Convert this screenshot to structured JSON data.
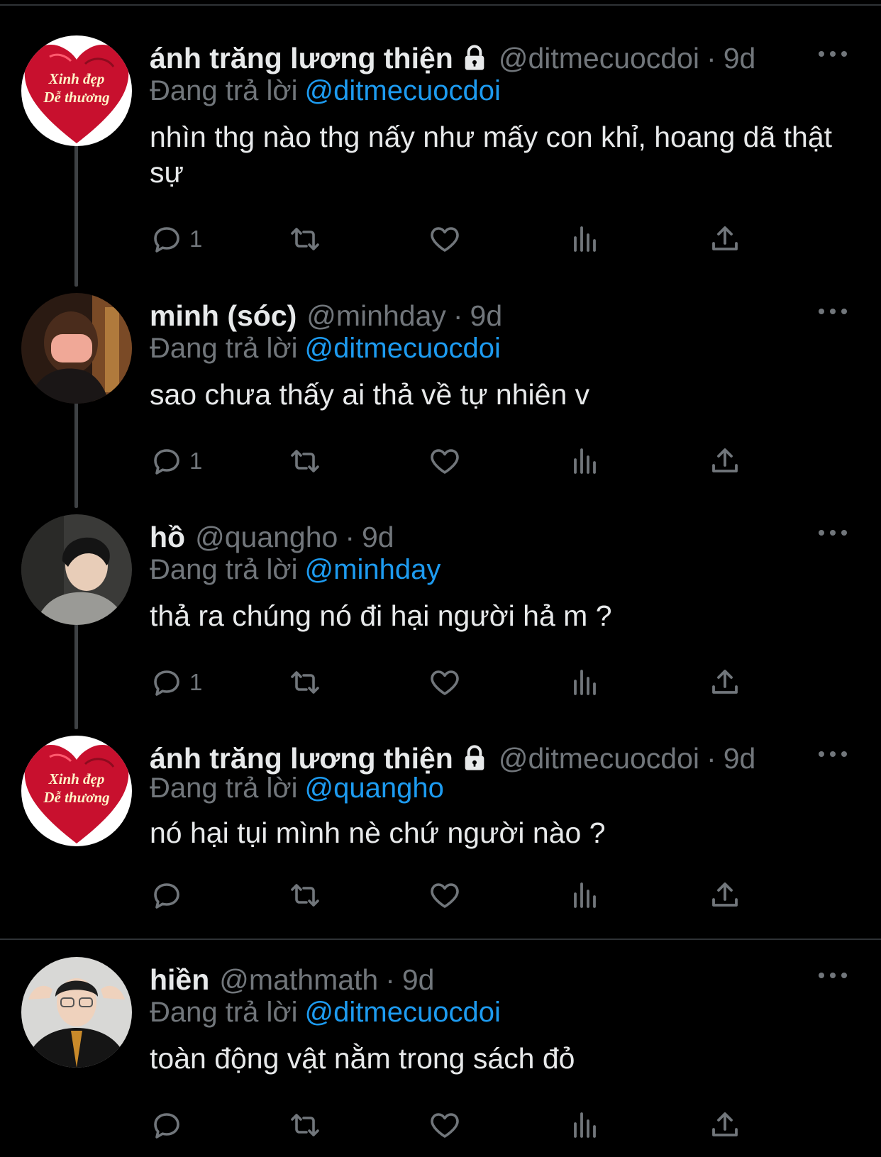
{
  "reply_prefix": "Đang trả lời",
  "tweets": [
    {
      "name": "ánh trăng lương thiện",
      "locked": true,
      "handle": "@ditmecuocdoi",
      "separator": "·",
      "time": "9d",
      "replying_to": "@ditmecuocdoi",
      "text": "nhìn thg nào thg nấy như mấy con khỉ, hoang dã thật sự",
      "reply_count": "1",
      "avatar": {
        "type": "heart",
        "line1": "Xinh đẹp",
        "line2": "Dễ thương"
      }
    },
    {
      "name": "minh (sóc)",
      "locked": false,
      "handle": "@minhday",
      "separator": "·",
      "time": "9d",
      "replying_to": "@ditmecuocdoi",
      "text": "sao chưa thấy ai thả về tự nhiên v",
      "reply_count": "1",
      "avatar": {
        "type": "photo"
      }
    },
    {
      "name": "hồ",
      "locked": false,
      "handle": "@quangho",
      "separator": "·",
      "time": "9d",
      "replying_to": "@minhday",
      "text": "thả ra chúng nó đi hại người hả m ?",
      "reply_count": "1",
      "avatar": {
        "type": "photo"
      }
    },
    {
      "name": "ánh trăng lương thiện",
      "locked": true,
      "handle": "@ditmecuocdoi",
      "separator": "·",
      "time": "9d",
      "replying_to": "@quangho",
      "text": "nó hại tụi mình nè chứ người nào ?",
      "reply_count": "",
      "avatar": {
        "type": "heart",
        "line1": "Xinh đẹp",
        "line2": "Dễ thương"
      }
    },
    {
      "name": "hiền",
      "locked": false,
      "handle": "@mathmath",
      "separator": "·",
      "time": "9d",
      "replying_to": "@ditmecuocdoi",
      "text": "toàn động vật nằm trong sách đỏ",
      "reply_count": "",
      "avatar": {
        "type": "photo"
      }
    }
  ],
  "colors": {
    "background": "#000000",
    "text": "#e7e9ea",
    "secondary": "#71767b",
    "mention": "#1d9bf0",
    "heart_red": "#c8102e"
  },
  "icons": [
    "reply-icon",
    "retweet-icon",
    "like-icon",
    "views-icon",
    "share-icon",
    "more-icon",
    "lock-icon"
  ]
}
